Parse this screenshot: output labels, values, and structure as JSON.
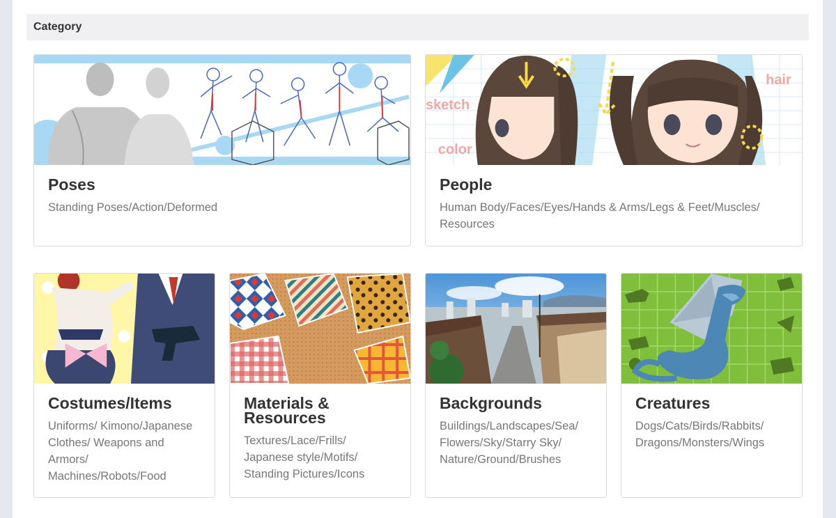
{
  "section": {
    "title": "Category"
  },
  "cards": [
    {
      "title": "Poses",
      "subtitle": "Standing Poses/Action/Deformed"
    },
    {
      "title": "People",
      "subtitle": "Human Body/Faces/Eyes/Hands & Arms/Legs & Feet/Muscles/ Resources",
      "thumb_text": {
        "sketch": "sketch",
        "color": "color",
        "hair": "hair"
      }
    },
    {
      "title": "Costumes/Items",
      "subtitle": "Uniforms/ Kimono/Japanese Clothes/ Weapons and Armors/ Machines/Robots/Food"
    },
    {
      "title": "Materials & Resources",
      "subtitle": "Textures/Lace/Frills/ Japanese style/Motifs/ Standing Pictures/Icons"
    },
    {
      "title": "Backgrounds",
      "subtitle": "Buildings/Landscapes/Sea/ Flowers/Sky/Starry Sky/ Nature/Ground/Brushes"
    },
    {
      "title": "Creatures",
      "subtitle": "Dogs/Cats/Birds/Rabbits/ Dragons/Monsters/Wings"
    }
  ],
  "colors": {
    "page_bg": "#e4e8f1",
    "header_bg": "#f0f0f2",
    "title_text": "#333333",
    "subtitle_text": "#777777",
    "card_border": "#d6d9dd"
  }
}
